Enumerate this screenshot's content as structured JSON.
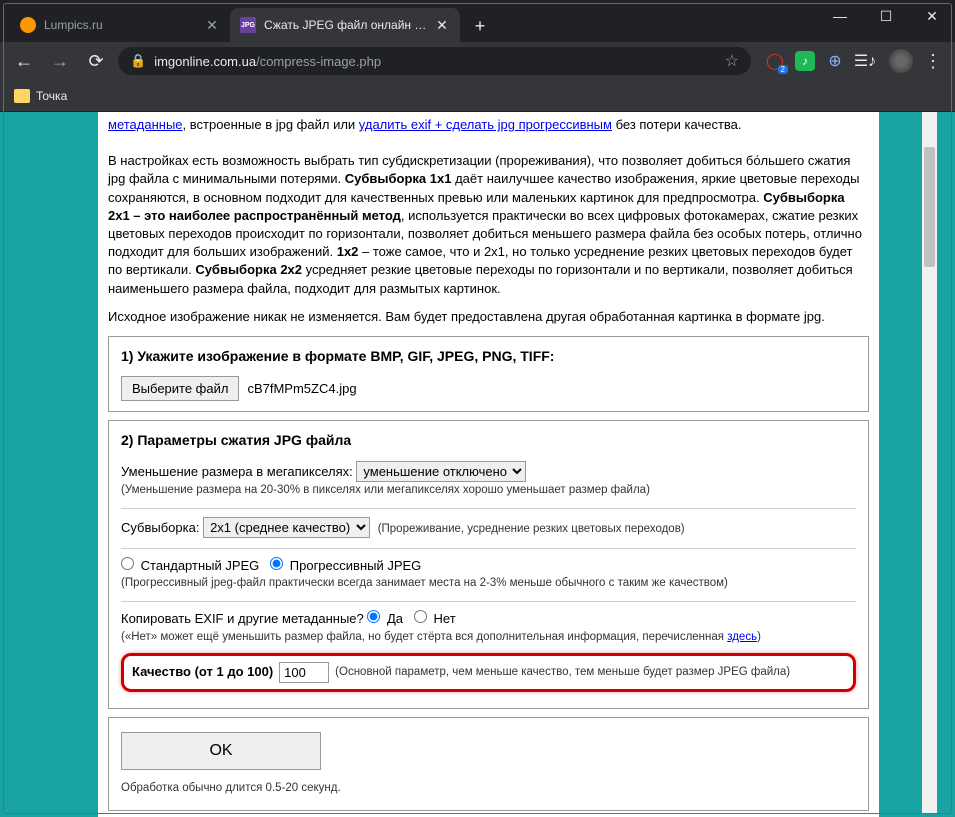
{
  "window": {
    "tabs": [
      {
        "title": "Lumpics.ru",
        "favicon_color": "#ff9800"
      },
      {
        "title": "Сжать JPEG файл онлайн - IMG",
        "favicon_text": "JPG",
        "favicon_bg": "#6b3fa0"
      }
    ],
    "controls": {
      "min": "—",
      "max": "☐",
      "close": "✕"
    }
  },
  "toolbar": {
    "url_domain": "imgonline.com.ua",
    "url_path": "/compress-image.php"
  },
  "bookmarks": {
    "item1": "Точка"
  },
  "intro": {
    "link1": "метаданные",
    "text1": ", встроенные в jpg файл или ",
    "link2": "удалить exif + сделать jpg прогрессивным",
    "text2": " без потери качества.",
    "para2": "В настройках есть возможность выбрать тип субдискретизации (прореживания), что позволяет добиться бо́льшего сжатия jpg файла с минимальными потерями. ",
    "b1": "Субвыборка 1x1",
    "para2b": " даёт наилучшее качество изображения, яркие цветовые переходы сохраняются, в основном подходит для качественных превью или маленьких картинок для предпросмотра. ",
    "b2": "Субвыборка 2x1 – это наиболее распространённый метод",
    "para2c": ", используется практически во всех цифровых фотокамерах, сжатие резких цветовых переходов происходит по горизонтали, позволяет добиться меньшего размера файла без особых потерь, отлично подходит для больших изображений. ",
    "b3": "1x2",
    "para2d": " – тоже самое, что и 2x1, но только усреднение резких цветовых переходов будет по вертикали. ",
    "b4": "Субвыборка 2x2",
    "para2e": " усредняет резкие цветовые переходы по горизонтали и по вертикали, позволяет добиться наименьшего размера файла, подходит для размытых картинок.",
    "para3": "Исходное изображение никак не изменяется. Вам будет предоставлена другая обработанная картинка в формате jpg."
  },
  "section1": {
    "title": "1) Укажите изображение в формате BMP, GIF, JPEG, PNG, TIFF:",
    "file_btn": "Выберите файл",
    "file_name": "cB7fMPm5ZC4.jpg"
  },
  "section2": {
    "title": "2) Параметры сжатия JPG файла",
    "mp_label": "Уменьшение размера в мегапикселях: ",
    "mp_option": "уменьшение отключено",
    "mp_hint": "(Уменьшение размера на 20-30% в пикселях или мегапикселях хорошо уменьшает размер файла)",
    "sub_label": "Субвыборка: ",
    "sub_option": "2x1 (среднее качество)",
    "sub_hint": "(Прореживание, усреднение резких цветовых переходов)",
    "jpeg_std": "Стандартный JPEG",
    "jpeg_prog": "Прогрессивный JPEG",
    "jpeg_hint": "(Прогрессивный jpeg-файл практически всегда занимает места на 2-3% меньше обычного с таким же качеством)",
    "exif_label": "Копировать EXIF и другие метаданные? ",
    "exif_yes": "Да",
    "exif_no": "Нет",
    "exif_hint_a": "(«Нет» может ещё уменьшить размер файла, но будет стёрта вся дополнительная информация, перечисленная ",
    "exif_hint_link": "здесь",
    "exif_hint_b": ")",
    "quality_label": "Качество (от 1 до 100)",
    "quality_value": "100",
    "quality_hint": "(Основной параметр, чем меньше качество, тем меньше будет размер JPEG файла)"
  },
  "section3": {
    "ok": "OK",
    "hint": "Обработка обычно длится 0.5-20 секунд."
  }
}
